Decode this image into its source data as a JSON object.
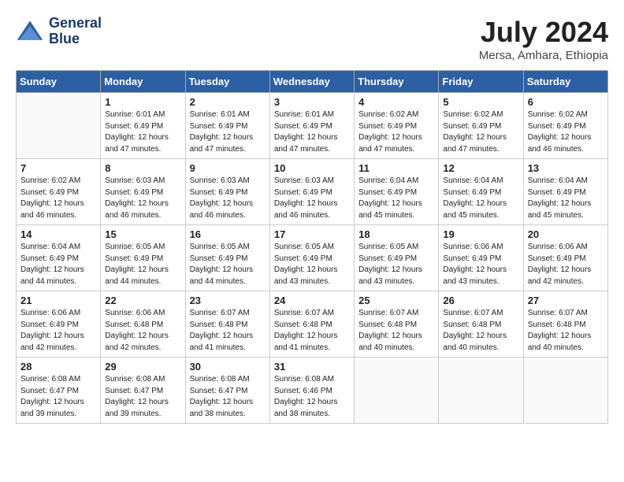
{
  "header": {
    "logo_line1": "General",
    "logo_line2": "Blue",
    "month": "July 2024",
    "location": "Mersa, Amhara, Ethiopia"
  },
  "days_of_week": [
    "Sunday",
    "Monday",
    "Tuesday",
    "Wednesday",
    "Thursday",
    "Friday",
    "Saturday"
  ],
  "weeks": [
    [
      {
        "day": "",
        "empty": true
      },
      {
        "day": "1",
        "sunrise": "6:01 AM",
        "sunset": "6:49 PM",
        "daylight": "12 hours and 47 minutes."
      },
      {
        "day": "2",
        "sunrise": "6:01 AM",
        "sunset": "6:49 PM",
        "daylight": "12 hours and 47 minutes."
      },
      {
        "day": "3",
        "sunrise": "6:01 AM",
        "sunset": "6:49 PM",
        "daylight": "12 hours and 47 minutes."
      },
      {
        "day": "4",
        "sunrise": "6:02 AM",
        "sunset": "6:49 PM",
        "daylight": "12 hours and 47 minutes."
      },
      {
        "day": "5",
        "sunrise": "6:02 AM",
        "sunset": "6:49 PM",
        "daylight": "12 hours and 47 minutes."
      },
      {
        "day": "6",
        "sunrise": "6:02 AM",
        "sunset": "6:49 PM",
        "daylight": "12 hours and 46 minutes."
      }
    ],
    [
      {
        "day": "7",
        "sunrise": "6:02 AM",
        "sunset": "6:49 PM",
        "daylight": "12 hours and 46 minutes."
      },
      {
        "day": "8",
        "sunrise": "6:03 AM",
        "sunset": "6:49 PM",
        "daylight": "12 hours and 46 minutes."
      },
      {
        "day": "9",
        "sunrise": "6:03 AM",
        "sunset": "6:49 PM",
        "daylight": "12 hours and 46 minutes."
      },
      {
        "day": "10",
        "sunrise": "6:03 AM",
        "sunset": "6:49 PM",
        "daylight": "12 hours and 46 minutes."
      },
      {
        "day": "11",
        "sunrise": "6:04 AM",
        "sunset": "6:49 PM",
        "daylight": "12 hours and 45 minutes."
      },
      {
        "day": "12",
        "sunrise": "6:04 AM",
        "sunset": "6:49 PM",
        "daylight": "12 hours and 45 minutes."
      },
      {
        "day": "13",
        "sunrise": "6:04 AM",
        "sunset": "6:49 PM",
        "daylight": "12 hours and 45 minutes."
      }
    ],
    [
      {
        "day": "14",
        "sunrise": "6:04 AM",
        "sunset": "6:49 PM",
        "daylight": "12 hours and 44 minutes."
      },
      {
        "day": "15",
        "sunrise": "6:05 AM",
        "sunset": "6:49 PM",
        "daylight": "12 hours and 44 minutes."
      },
      {
        "day": "16",
        "sunrise": "6:05 AM",
        "sunset": "6:49 PM",
        "daylight": "12 hours and 44 minutes."
      },
      {
        "day": "17",
        "sunrise": "6:05 AM",
        "sunset": "6:49 PM",
        "daylight": "12 hours and 43 minutes."
      },
      {
        "day": "18",
        "sunrise": "6:05 AM",
        "sunset": "6:49 PM",
        "daylight": "12 hours and 43 minutes."
      },
      {
        "day": "19",
        "sunrise": "6:06 AM",
        "sunset": "6:49 PM",
        "daylight": "12 hours and 43 minutes."
      },
      {
        "day": "20",
        "sunrise": "6:06 AM",
        "sunset": "6:49 PM",
        "daylight": "12 hours and 42 minutes."
      }
    ],
    [
      {
        "day": "21",
        "sunrise": "6:06 AM",
        "sunset": "6:49 PM",
        "daylight": "12 hours and 42 minutes."
      },
      {
        "day": "22",
        "sunrise": "6:06 AM",
        "sunset": "6:48 PM",
        "daylight": "12 hours and 42 minutes."
      },
      {
        "day": "23",
        "sunrise": "6:07 AM",
        "sunset": "6:48 PM",
        "daylight": "12 hours and 41 minutes."
      },
      {
        "day": "24",
        "sunrise": "6:07 AM",
        "sunset": "6:48 PM",
        "daylight": "12 hours and 41 minutes."
      },
      {
        "day": "25",
        "sunrise": "6:07 AM",
        "sunset": "6:48 PM",
        "daylight": "12 hours and 40 minutes."
      },
      {
        "day": "26",
        "sunrise": "6:07 AM",
        "sunset": "6:48 PM",
        "daylight": "12 hours and 40 minutes."
      },
      {
        "day": "27",
        "sunrise": "6:07 AM",
        "sunset": "6:48 PM",
        "daylight": "12 hours and 40 minutes."
      }
    ],
    [
      {
        "day": "28",
        "sunrise": "6:08 AM",
        "sunset": "6:47 PM",
        "daylight": "12 hours and 39 minutes."
      },
      {
        "day": "29",
        "sunrise": "6:08 AM",
        "sunset": "6:47 PM",
        "daylight": "12 hours and 39 minutes."
      },
      {
        "day": "30",
        "sunrise": "6:08 AM",
        "sunset": "6:47 PM",
        "daylight": "12 hours and 38 minutes."
      },
      {
        "day": "31",
        "sunrise": "6:08 AM",
        "sunset": "6:46 PM",
        "daylight": "12 hours and 38 minutes."
      },
      {
        "day": "",
        "empty": true
      },
      {
        "day": "",
        "empty": true
      },
      {
        "day": "",
        "empty": true
      }
    ]
  ]
}
